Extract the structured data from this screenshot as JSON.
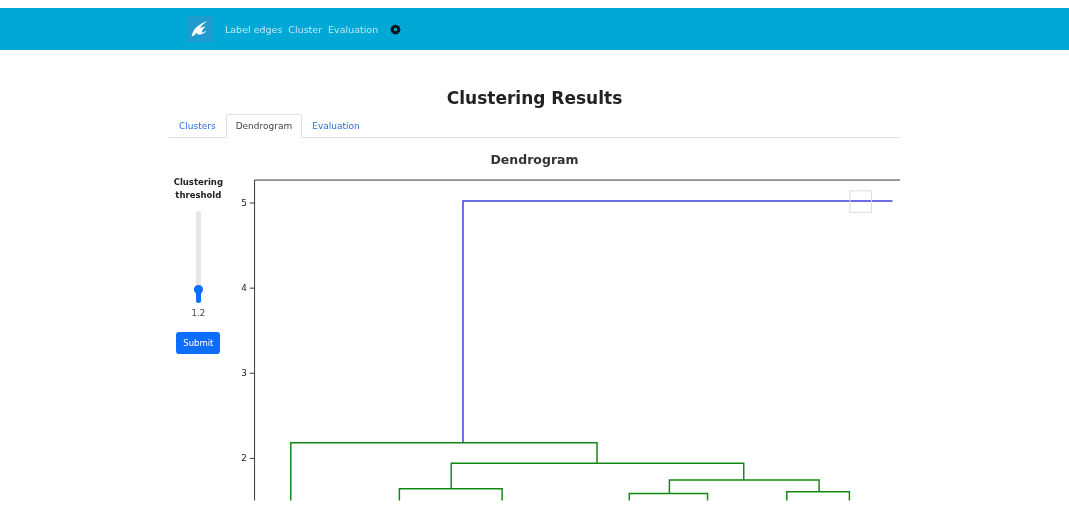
{
  "navbar": {
    "links": [
      {
        "label": "Label edges"
      },
      {
        "label": "Cluster"
      },
      {
        "label": "Evaluation"
      }
    ]
  },
  "page_title": "Clustering Results",
  "tabs": [
    {
      "label": "Clusters",
      "selected": false
    },
    {
      "label": "Dendrogram",
      "selected": true
    },
    {
      "label": "Evaluation",
      "selected": false
    }
  ],
  "sidebar": {
    "label": "Clustering threshold",
    "value": "1.2",
    "button": "Submit"
  },
  "dendrogram": {
    "title": "Dendrogram",
    "y_ticks": [
      "5",
      "4",
      "3",
      "2"
    ]
  }
}
